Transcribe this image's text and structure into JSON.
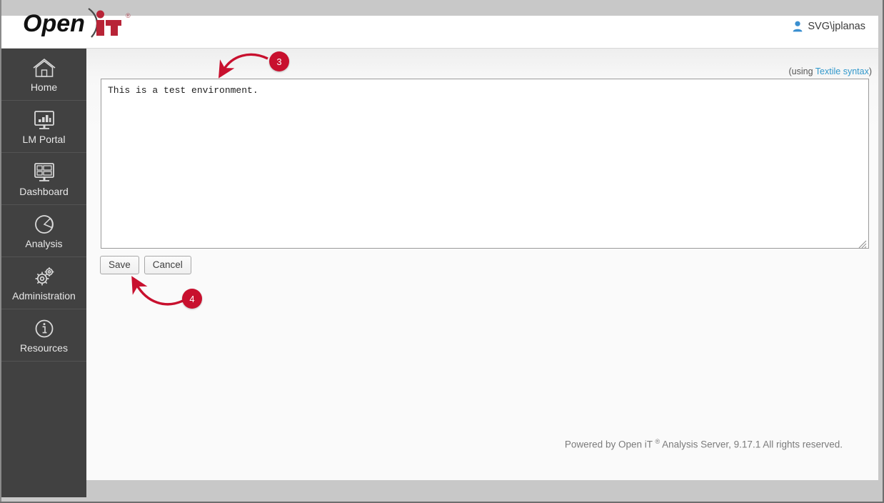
{
  "app": {
    "brand_primary_text": "Open",
    "brand_accent_text": "iT",
    "brand_registered": "®"
  },
  "header": {
    "user_icon": "user-icon",
    "user_label": "SVG\\jplanas"
  },
  "sidebar": {
    "items": [
      {
        "label": "Home",
        "icon": "home-icon"
      },
      {
        "label": "LM Portal",
        "icon": "monitor-chart-icon"
      },
      {
        "label": "Dashboard",
        "icon": "dashboard-layout-icon"
      },
      {
        "label": "Analysis",
        "icon": "pie-chart-icon"
      },
      {
        "label": "Administration",
        "icon": "gears-icon"
      },
      {
        "label": "Resources",
        "icon": "info-circle-icon"
      }
    ]
  },
  "main": {
    "syntax_note_prefix": "(using ",
    "syntax_note_link": "Textile syntax",
    "syntax_note_suffix": ")",
    "editor_value": "This is a test environment.",
    "editor_placeholder": "",
    "save_label": "Save",
    "cancel_label": "Cancel",
    "resize_handle": "resize-grip-icon"
  },
  "footer": {
    "text_before": "Powered by Open iT ",
    "registered": "®",
    "text_after": " Analysis Server, 9.17.1 All rights reserved."
  },
  "annotations": [
    {
      "number": "3",
      "target": "description-textarea"
    },
    {
      "number": "4",
      "target": "save-button"
    }
  ],
  "colors": {
    "accent_red": "#c8102e",
    "sidebar_bg": "#414141",
    "link_blue": "#3399cc",
    "chrome_gray": "#c8c8c8"
  }
}
